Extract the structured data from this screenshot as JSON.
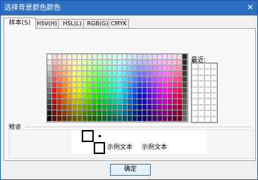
{
  "window": {
    "title": "选择背景颜色颜色"
  },
  "controls": {
    "close_glyph": "✕"
  },
  "tabs": [
    {
      "label": "样本(S)",
      "mnemonic_note": "S"
    },
    {
      "label": "HSV(H)"
    },
    {
      "label": "HSL(L)"
    },
    {
      "label": "RGB(G)"
    },
    {
      "label": "CMYK"
    }
  ],
  "swatches": {
    "recent_label": "最近:"
  },
  "preview": {
    "label": "预览",
    "sample_text_light": "示例文本",
    "sample_text_light2": "示例文本",
    "sample_text_dark": "示例文本",
    "sample_text_dark2": "示例文本"
  },
  "buttons": {
    "ok": "确定"
  },
  "colors": {
    "titlebar": "#2c6fc1",
    "dialog_bg": "#f0f0f0",
    "button_border": "#3c7fb1"
  }
}
